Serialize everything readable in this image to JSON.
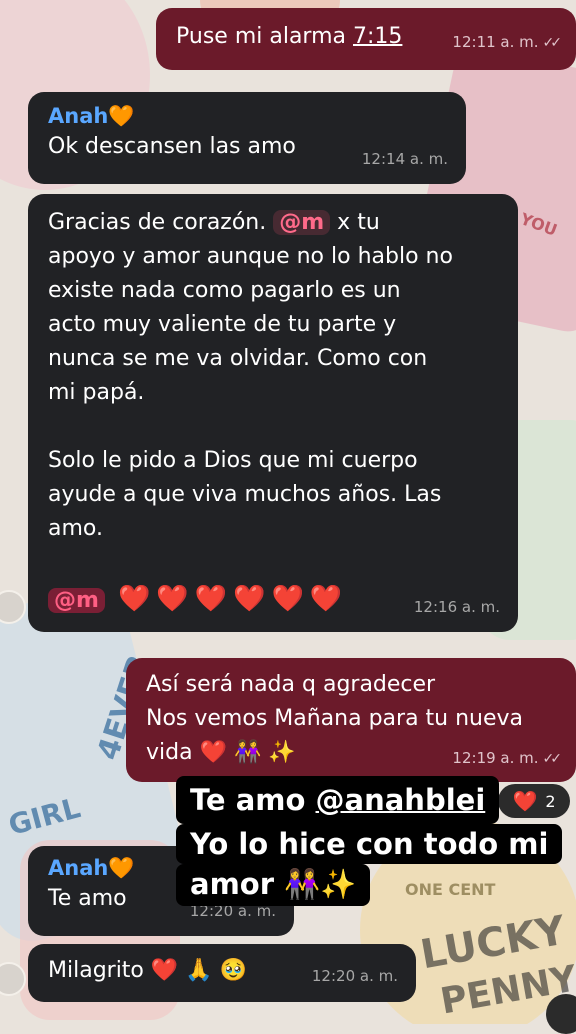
{
  "messages": [
    {
      "id": "m1",
      "direction": "outgoing",
      "text": "Puse mi alarma",
      "time_link": "7:15",
      "time": "12:11 a. m.",
      "status": "read"
    },
    {
      "id": "m2",
      "direction": "incoming",
      "sender": "Anah🧡",
      "text": "Ok descansen las amo",
      "time": "12:14 a. m."
    },
    {
      "id": "m3",
      "direction": "incoming",
      "line1_a": "Gracias de corazón.",
      "mention": "@m",
      "line1_b": " x tu",
      "lines": [
        "apoyo y amor aunque no lo hablo  no",
        "existe nada como pagarlo es un",
        "acto muy valiente de tu parte y",
        "nunca se me va olvidar. Como con",
        "mi papá."
      ],
      "lines2": [
        "Solo le pido a Dios que mi cuerpo",
        "ayude a que viva muchos años.   Las",
        "amo."
      ],
      "mention2": "@m",
      "hearts": [
        "❤️",
        "❤️",
        "❤️",
        "❤️",
        "❤️",
        "❤️"
      ],
      "time": "12:16 a. m."
    },
    {
      "id": "m4",
      "direction": "outgoing",
      "lines": [
        "Así será nada q agradecer",
        "Nos vemos Mañana para tu nueva",
        "vida ❤️ 👭 ✨"
      ],
      "time": "12:19 a. m.",
      "status": "read"
    },
    {
      "id": "m5",
      "direction": "incoming",
      "sender": "Anah🧡",
      "text": "Te amo",
      "time": "12:20 a. m."
    },
    {
      "id": "m6",
      "direction": "incoming",
      "text": "Milagrito ❤️ 🙏 🥹",
      "time": "12:20 a. m."
    }
  ],
  "reaction": {
    "emoji": "❤️",
    "count": "2"
  },
  "overlay": {
    "line1_prefix": "Te amo ",
    "line1_handle": "@anahblei",
    "line2": "Yo lo hice con todo mi",
    "line3": "amor 👭✨"
  },
  "wallpaper": {
    "texts": [
      "GIRL",
      "4EVER",
      "LUCKY",
      "PENNY",
      "ONE CENT",
      "YOU"
    ]
  },
  "colors": {
    "incoming_bubble": "#212225",
    "outgoing_bubble": "#6b1a2a",
    "sender_name": "#5aa7ff",
    "mention": "#ff5f84"
  }
}
